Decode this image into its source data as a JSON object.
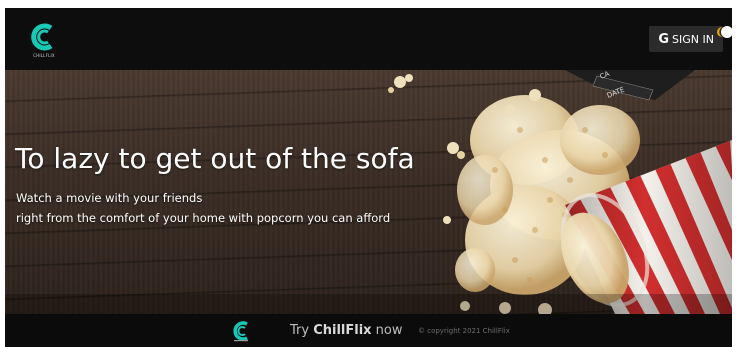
{
  "brand": {
    "logo_caption": "CHILLFLIX",
    "accent_color": "#19c7b5"
  },
  "header": {
    "signin_icon": "G",
    "signin_label": "SIGN IN"
  },
  "hero": {
    "title": "To lazy to get out of the sofa",
    "line1": "Watch a movie with your friends",
    "line2": "right from the comfort of your home with popcorn you can afford"
  },
  "clapper": {
    "label1": "CA",
    "label2": "DATE"
  },
  "footer": {
    "cta_prefix": "Try ",
    "cta_brand": "ChillFlix",
    "cta_suffix": " now",
    "copyright": "© copyright 2021 ChillFlix"
  },
  "icons": {
    "logo": "chillflix-logo-icon",
    "footer_logo": "chillflix-logo-icon",
    "theme_toggle": "moon-toggle-icon"
  }
}
